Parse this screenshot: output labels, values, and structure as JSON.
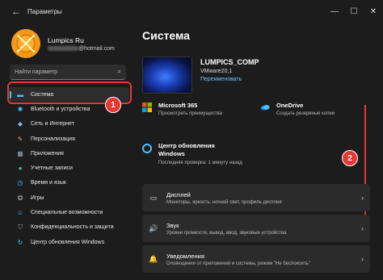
{
  "window": {
    "back_icon": "back-arrow-icon",
    "title": "Параметры",
    "minimize": "—",
    "maximize": "☐",
    "close": "✕"
  },
  "user": {
    "name": "Lumpics Ru",
    "email_suffix": "@hotmail.com"
  },
  "search": {
    "placeholder": "Найти параметр",
    "icon": "⌕"
  },
  "nav": {
    "items": [
      {
        "label": "Система",
        "icon": "▬",
        "color": "#4cc2ff"
      },
      {
        "label": "Bluetooth и устройства",
        "icon": "✱",
        "color": "#4cc2ff"
      },
      {
        "label": "Сеть и Интернет",
        "icon": "◆",
        "color": "#7fb3e6"
      },
      {
        "label": "Персонализация",
        "icon": "✎",
        "color": "#e0a060"
      },
      {
        "label": "Приложения",
        "icon": "▦",
        "color": "#9aa6b8"
      },
      {
        "label": "Учетные записи",
        "icon": "●",
        "color": "#4cc28a"
      },
      {
        "label": "Время и язык",
        "icon": "◷",
        "color": "#4cc2ff"
      },
      {
        "label": "Игры",
        "icon": "✪",
        "color": "#aaaaaa"
      },
      {
        "label": "Специальные возможности",
        "icon": "☺",
        "color": "#4cc2ff"
      },
      {
        "label": "Конфиденциальность и защита",
        "icon": "⛉",
        "color": "#9aa6b8"
      },
      {
        "label": "Центр обновления Windows",
        "icon": "↻",
        "color": "#4cc2ff"
      }
    ]
  },
  "annotations": {
    "badge1": "1",
    "badge2": "2",
    "accent": "#e53935"
  },
  "main": {
    "title": "Система",
    "device": {
      "name": "LUMPICS_COMP",
      "model": "VMware20,1",
      "rename": "Переименовать"
    },
    "tiles": [
      {
        "title": "Microsoft 365",
        "sub": "Просмотреть преимущества",
        "icon": "windows-logo-icon"
      },
      {
        "title": "OneDrive",
        "sub": "Создать резервные копии",
        "icon": "cloud-icon"
      }
    ],
    "update": {
      "title": "Центр обновления Windows",
      "sub": "Последняя проверка: 1 минуту назад"
    },
    "rows": [
      {
        "title": "Дисплей",
        "sub": "Мониторы, яркость, ночной свет, профиль дисплея",
        "icon": "▭"
      },
      {
        "title": "Звук",
        "sub": "Уровни громкости, вывод, ввод, звуковые устройства",
        "icon": "🔊"
      },
      {
        "title": "Уведомления",
        "sub": "Оповещения от приложений и системы, режим \"Не беспокоить\"",
        "icon": "🔔"
      }
    ],
    "chevron": "›"
  }
}
